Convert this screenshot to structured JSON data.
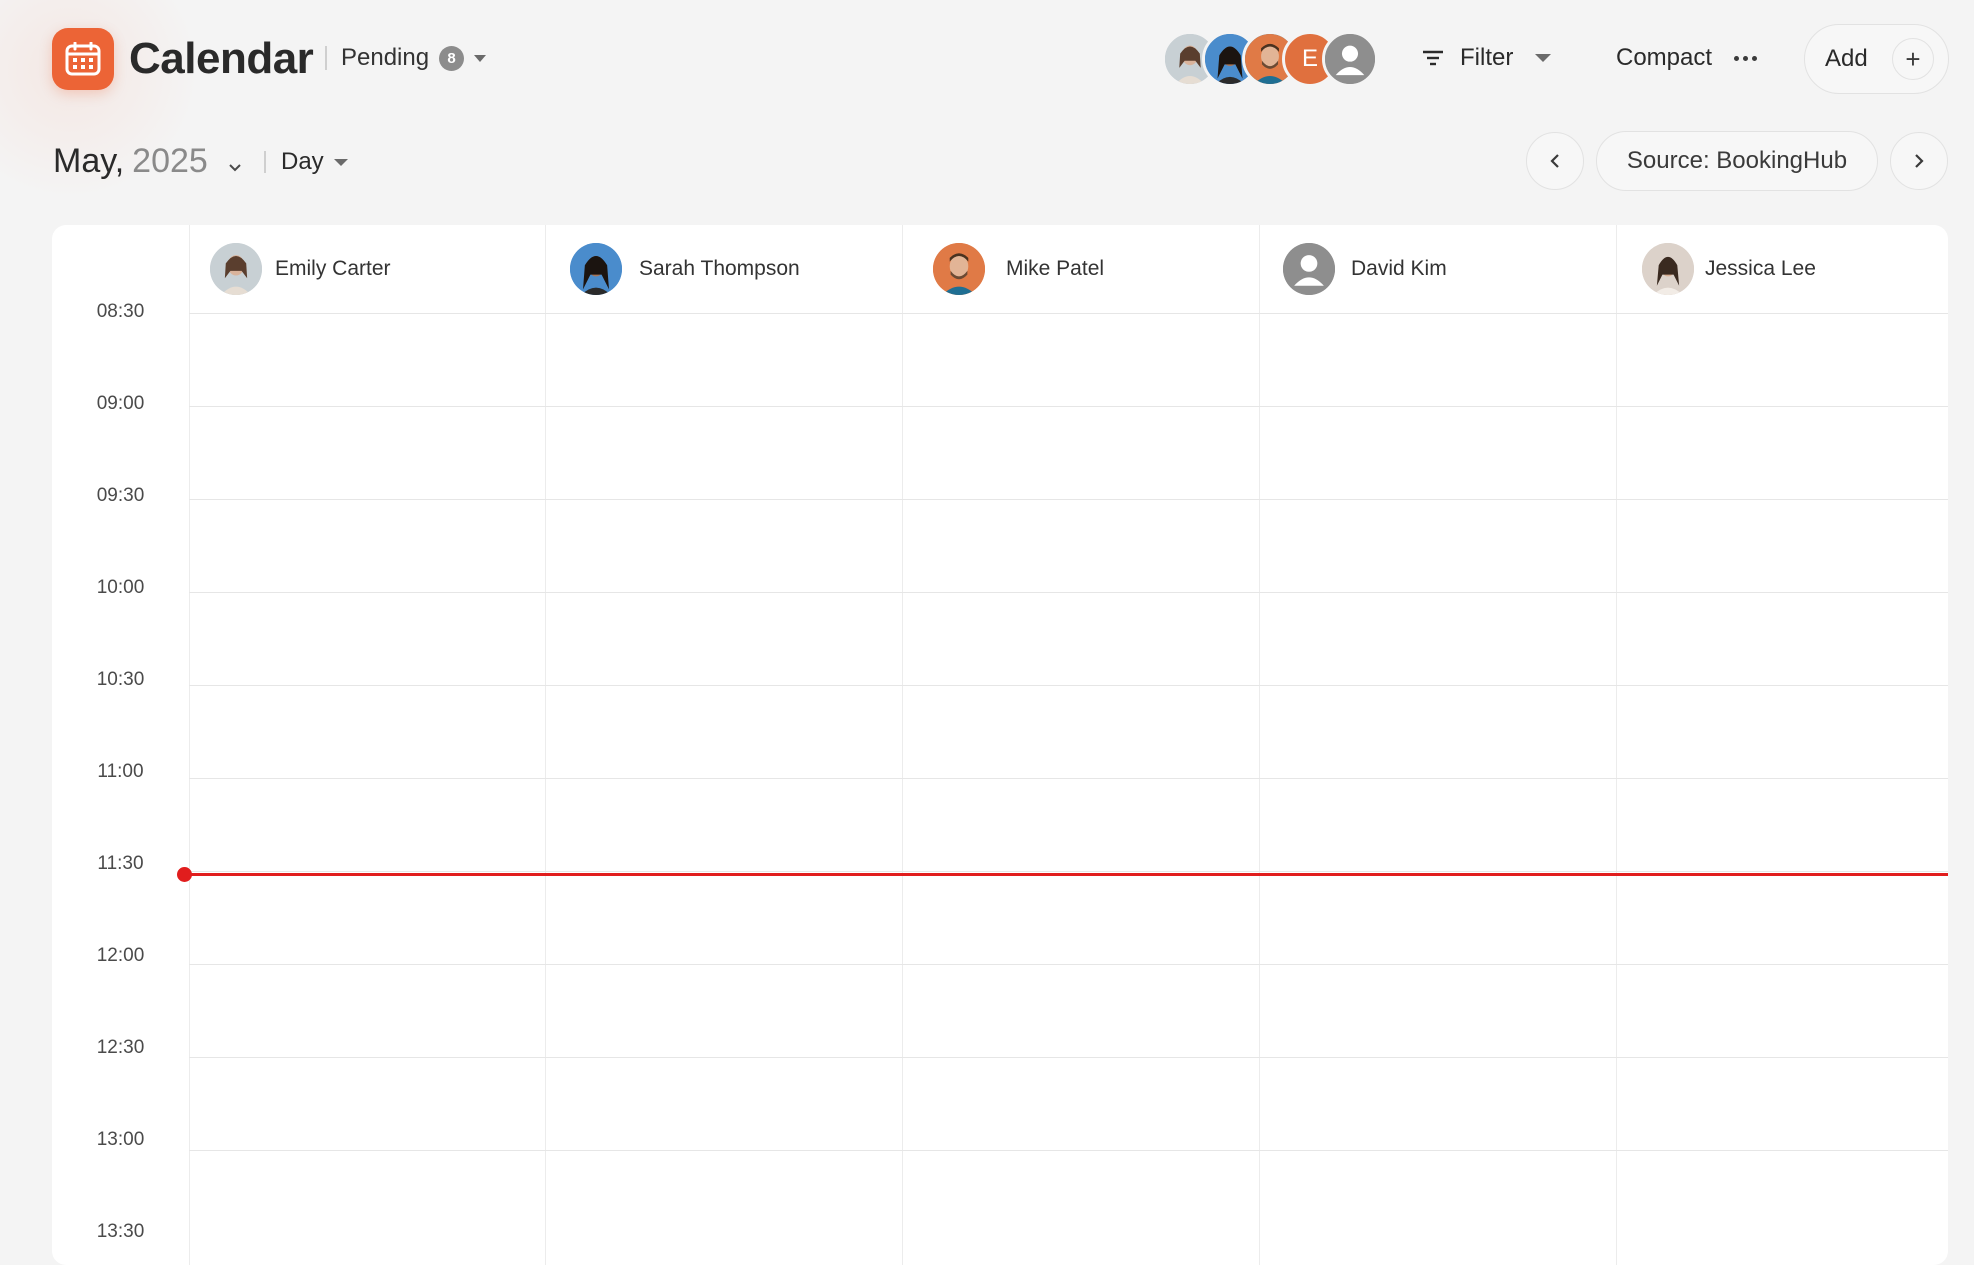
{
  "header": {
    "app_title": "Calendar",
    "pending_label": "Pending",
    "pending_count": "8",
    "avatar_initial": "E",
    "filter_label": "Filter",
    "compact_label": "Compact",
    "add_label": "Add",
    "add_symbol": "+"
  },
  "toolbar": {
    "month": "May,",
    "year": "2025",
    "view": "Day",
    "source_label": "Source: BookingHub"
  },
  "colors": {
    "accent": "#ec6436",
    "now_line": "#e11d1d"
  },
  "icons": [
    "calendar-icon",
    "chevron-down-icon",
    "filter-icon",
    "more-icon",
    "plus-icon",
    "chevron-left-icon",
    "chevron-right-icon",
    "user-icon"
  ],
  "staff": [
    {
      "name": "Emily Carter"
    },
    {
      "name": "Sarah Thompson"
    },
    {
      "name": "Mike Patel"
    },
    {
      "name": "David Kim"
    },
    {
      "name": "Jessica Lee"
    }
  ],
  "times": [
    "08:30",
    "09:00",
    "09:30",
    "10:00",
    "10:30",
    "11:00",
    "11:30",
    "12:00",
    "12:30",
    "13:00",
    "13:30"
  ]
}
